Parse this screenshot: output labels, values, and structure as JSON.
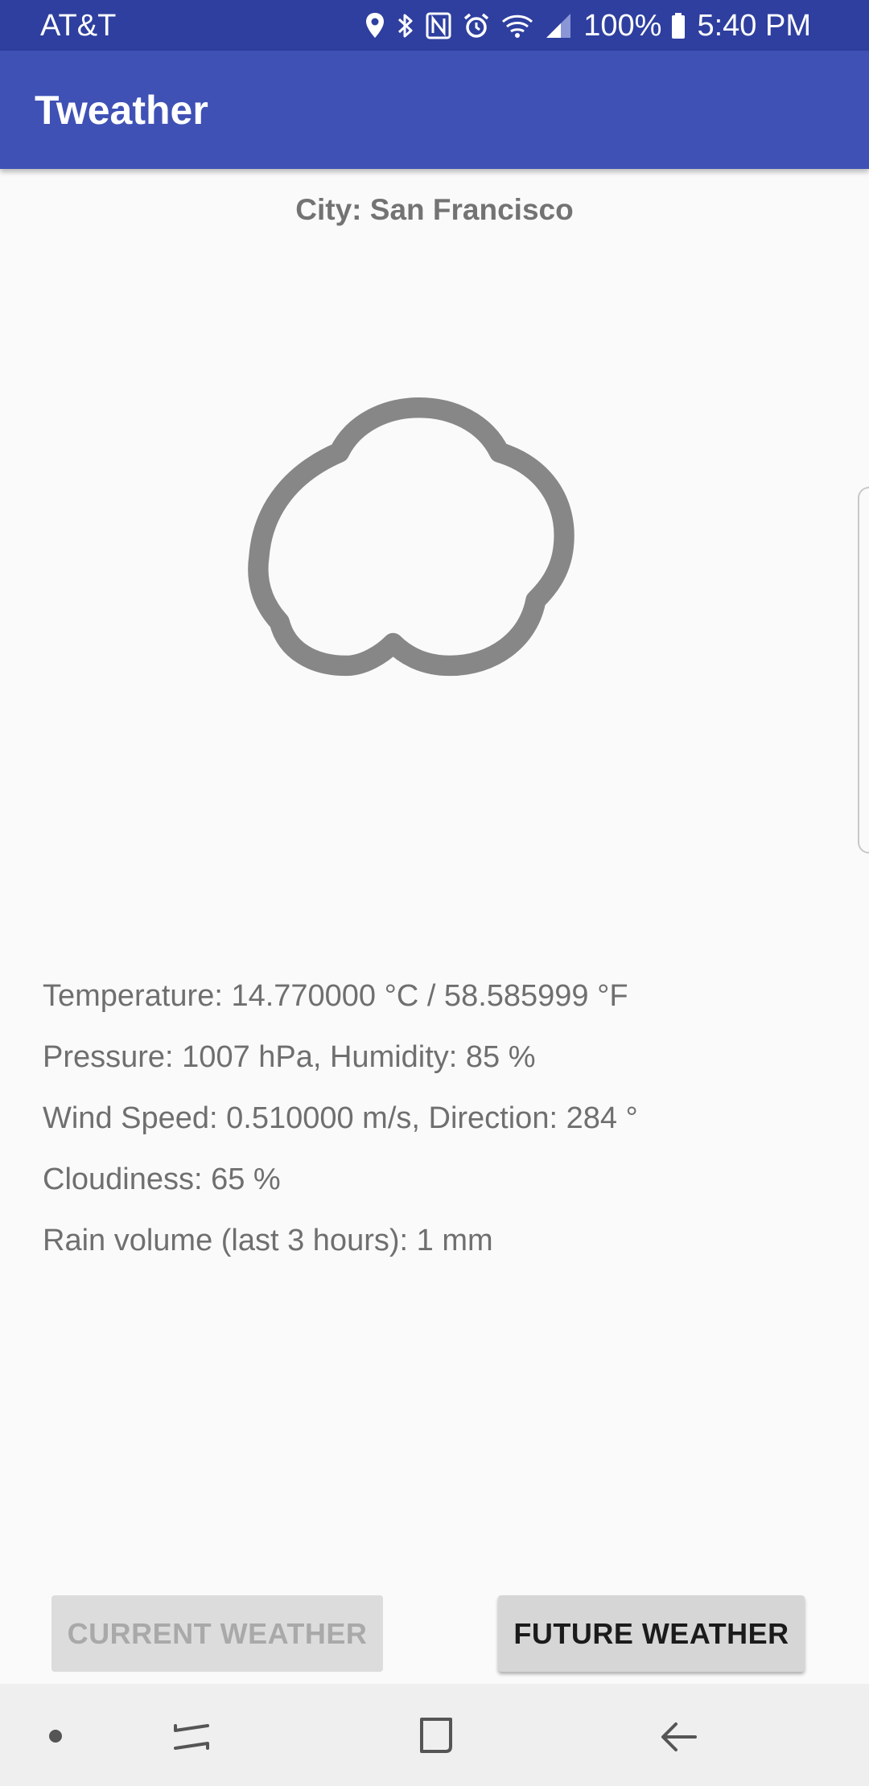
{
  "status_bar": {
    "carrier": "AT&T",
    "battery_percent": "100%",
    "time": "5:40 PM",
    "icons": [
      "location-icon",
      "bluetooth-icon",
      "nfc-icon",
      "alarm-icon",
      "wifi-icon",
      "signal-icon",
      "battery-icon"
    ]
  },
  "app_bar": {
    "title": "Tweather",
    "color": "#3f51b5"
  },
  "city": "City: San Francisco",
  "weather_icon": "cloud-icon",
  "details": [
    "Temperature: 14.770000 °C / 58.585999 °F",
    "Pressure: 1007 hPa, Humidity: 85 %",
    "Wind Speed: 0.510000 m/s, Direction: 284 °",
    "Cloudiness: 65 %",
    "Rain volume (last 3 hours): 1 mm"
  ],
  "buttons": {
    "current_weather": "CURRENT WEATHER",
    "future_weather": "FUTURE WEATHER"
  },
  "nav_bar": {
    "icons": [
      "home-dot-icon",
      "recents-icon",
      "overview-icon",
      "back-icon"
    ]
  }
}
